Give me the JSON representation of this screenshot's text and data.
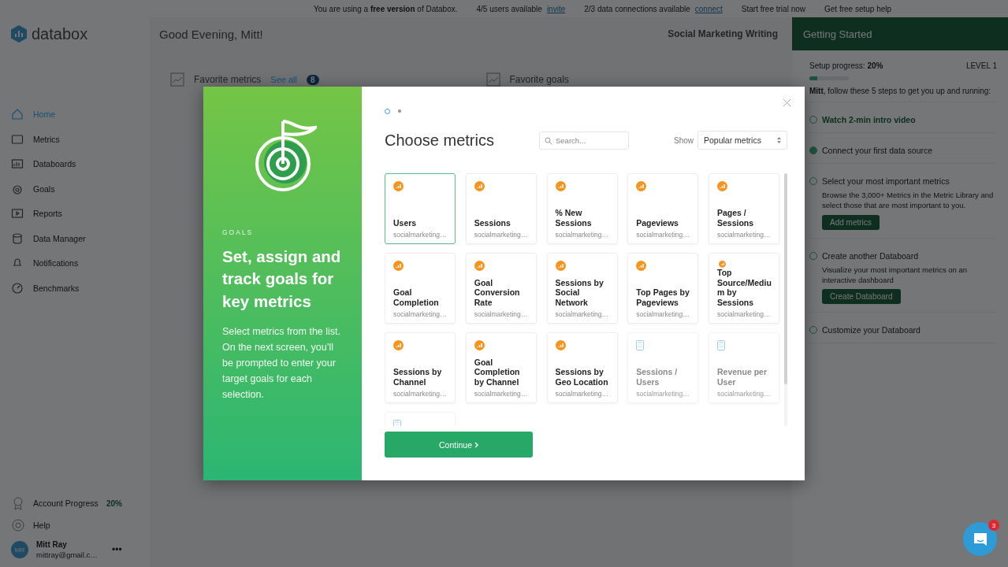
{
  "banner": {
    "notice": "You are using a **free version** of Databox.",
    "users": "4/5 users available",
    "users_link": "invite",
    "connections": "2/3 data connections available",
    "connections_link": "connect",
    "trial": "Start free trial now",
    "setup_help": "Get free setup help"
  },
  "logo": "databox",
  "greeting": "Good Evening, Mitt!",
  "databoard_name": "Social Marketing Writing",
  "sidebar": {
    "items": [
      {
        "label": "Home",
        "selected": true
      },
      {
        "label": "Metrics",
        "selected": false
      },
      {
        "label": "Databoards",
        "selected": false
      },
      {
        "label": "Goals",
        "selected": false
      },
      {
        "label": "Reports",
        "selected": false
      },
      {
        "label": "Data Manager",
        "selected": false
      },
      {
        "label": "Notifications",
        "selected": false
      },
      {
        "label": "Benchmarks",
        "selected": false
      }
    ],
    "account_progress": {
      "label": "Account Progress",
      "value": "20%"
    },
    "help": "Help",
    "user": {
      "initials": "MR",
      "name": "Mitt Ray",
      "email": "mittray@gmail.c…",
      "more": "•••"
    }
  },
  "widgets": [
    {
      "title": "Favorite metrics",
      "link": "See all",
      "count": "8"
    },
    {
      "title": "Favorite goals"
    }
  ],
  "getting_started": {
    "title": "Getting Started",
    "progress_label": "Setup progress: **20%**",
    "level_label": "LEVEL 1",
    "level": 0.2,
    "intro": "**Mitt**, follow these 5 steps to get you up and running:",
    "steps": [
      {
        "title": "Watch 2-min intro video",
        "kind": "link",
        "done": false
      },
      {
        "title": "Connect your first data source",
        "kind": "plain",
        "done": true
      },
      {
        "title": "Select your most important metrics",
        "kind": "task",
        "done": false,
        "description": "Browse the 3,000+ Metrics in the Metric Library and select those that are most important to you.",
        "button": "Add metrics"
      },
      {
        "title": "Create another Databoard",
        "kind": "task",
        "done": false,
        "description": "Visualize your most important metrics on an interactive dashboard",
        "button": "Create Databoard"
      },
      {
        "title": "Customize your Databoard",
        "kind": "task",
        "done": false
      }
    ]
  },
  "modal": {
    "eyebrow": "GOALS",
    "headline": "Set, assign and track goals for key metrics",
    "body": "Select metrics from the list. On the next screen, you’ll be prompted to enter your target goals for each selection.",
    "steps": [
      {
        "selected": true
      },
      {
        "selected": false
      }
    ],
    "title": "Choose metrics",
    "search": {
      "placeholder": "Search..."
    },
    "show_label": "Show",
    "show_value": "Popular metrics",
    "cards": [
      {
        "kind": "source",
        "name": "Users",
        "subtitle": "socialmarketing…",
        "selected": true,
        "disabled": false
      },
      {
        "kind": "source",
        "name": "Sessions",
        "subtitle": "socialmarketing…",
        "selected": false,
        "disabled": false
      },
      {
        "kind": "source",
        "name": "% New Sessions",
        "subtitle": "socialmarketing…",
        "selected": false,
        "disabled": false
      },
      {
        "kind": "source",
        "name": "Pageviews",
        "subtitle": "socialmarketing…",
        "selected": false,
        "disabled": false
      },
      {
        "kind": "source",
        "name": "Pages / Sessions",
        "subtitle": "socialmarketing…",
        "selected": false,
        "disabled": false
      },
      {
        "kind": "source",
        "name": "Goal Completion",
        "subtitle": "socialmarketing…",
        "selected": false,
        "disabled": false
      },
      {
        "kind": "source",
        "name": "Goal Conversion Rate",
        "subtitle": "socialmarketing…",
        "selected": false,
        "disabled": false
      },
      {
        "kind": "source",
        "name": "Sessions by Social Network",
        "subtitle": "socialmarketing…",
        "selected": false,
        "disabled": false
      },
      {
        "kind": "source",
        "name": "Top Pages by Pageviews",
        "subtitle": "socialmarketing…",
        "selected": false,
        "disabled": false
      },
      {
        "kind": "source",
        "name": "Top Source/Mediu m by Sessions",
        "subtitle": "socialmarketing…",
        "selected": false,
        "disabled": false
      },
      {
        "kind": "source",
        "name": "Sessions by Channel",
        "subtitle": "socialmarketing…",
        "selected": false,
        "disabled": false
      },
      {
        "kind": "source",
        "name": "Goal Completion by Channel",
        "subtitle": "socialmarketing…",
        "selected": false,
        "disabled": false
      },
      {
        "kind": "source",
        "name": "Sessions by Geo Location",
        "subtitle": "socialmarketing…",
        "selected": false,
        "disabled": false
      },
      {
        "kind": "calculated",
        "name": "Sessions / Users",
        "subtitle": "socialmarketing…",
        "selected": false,
        "disabled": true
      },
      {
        "kind": "calculated",
        "name": "Revenue per User",
        "subtitle": "socialmarketing…",
        "selected": false,
        "disabled": true
      },
      {
        "kind": "calculated",
        "selected": false,
        "disabled": true
      }
    ],
    "continue": "Continue"
  },
  "chat": {
    "badge": "3"
  }
}
